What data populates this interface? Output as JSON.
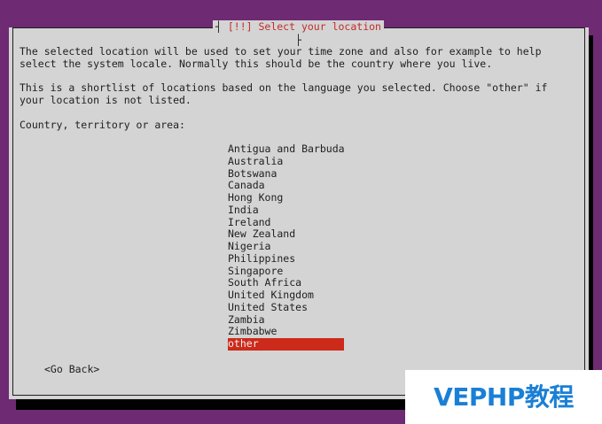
{
  "dialog": {
    "title": "[!!] Select your location",
    "description": [
      "The selected location will be used to set your time zone and also for example to help",
      "select the system locale. Normally this should be the country where you live.",
      "",
      "This is a shortlist of locations based on the language you selected. Choose \"other\" if",
      "your location is not listed.",
      "",
      "Country, territory or area:"
    ],
    "countries": [
      "Antigua and Barbuda",
      "Australia",
      "Botswana",
      "Canada",
      "Hong Kong",
      "India",
      "Ireland",
      "New Zealand",
      "Nigeria",
      "Philippines",
      "Singapore",
      "South Africa",
      "United Kingdom",
      "United States",
      "Zambia",
      "Zimbabwe",
      "other"
    ],
    "selected_country": "other",
    "go_back_label": "<Go Back>"
  },
  "watermark": {
    "text": "VEPHP教程",
    "color": "#1a7fd6"
  },
  "colors": {
    "background": "#6e2a73",
    "dialog": "#d4d4d4",
    "highlight": "#cc2a1a",
    "title": "#c32c2c"
  }
}
